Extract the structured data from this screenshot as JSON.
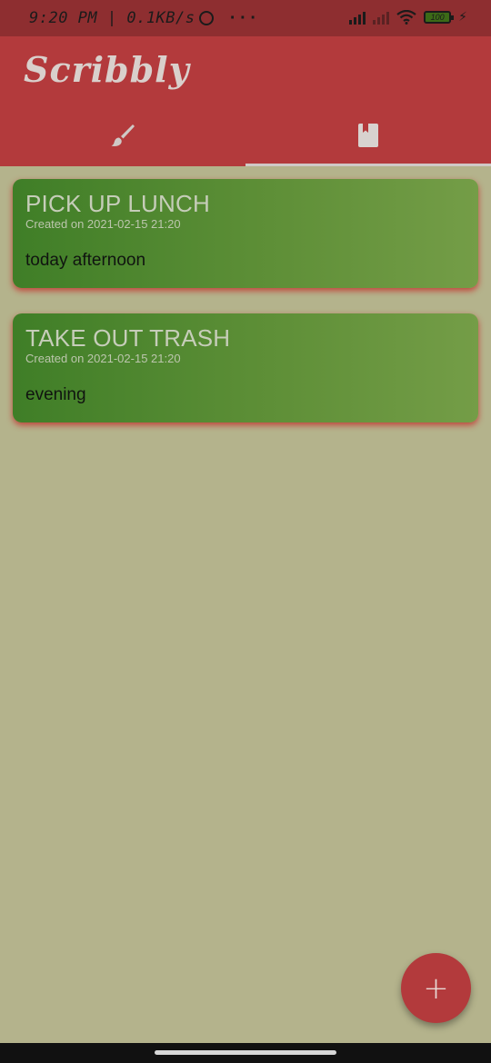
{
  "status_bar": {
    "time_and_speed": "9:20 PM | 0.1KB/s",
    "overflow_dots": "···",
    "battery_level": "100"
  },
  "app_bar": {
    "title": "Scribbly",
    "tabs": [
      {
        "icon": "paintbrush-icon",
        "selected": false
      },
      {
        "icon": "notebook-icon",
        "selected": true
      }
    ]
  },
  "notes": [
    {
      "title": "PICK UP LUNCH",
      "created": "Created on 2021-02-15 21:20",
      "body": "today afternoon"
    },
    {
      "title": "TAKE OUT TRASH",
      "created": "Created on 2021-02-15 21:20",
      "body": "evening"
    }
  ],
  "fab": {
    "label": "+"
  },
  "colors": {
    "background": "#b4b38c",
    "app_bar": "#b33a3c",
    "status_bar": "#8e2e30",
    "card_green": "#5e8f37",
    "card_shadow": "#c62020"
  }
}
